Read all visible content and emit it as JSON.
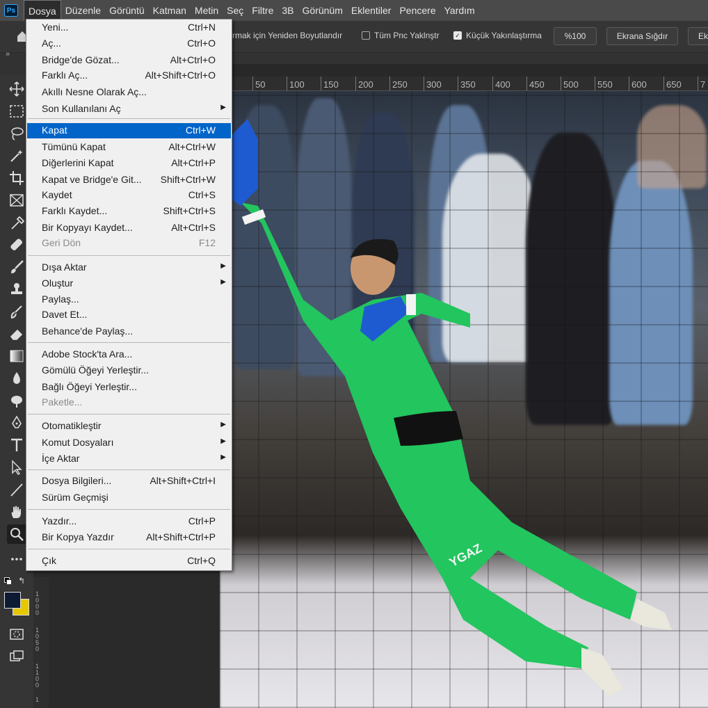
{
  "menubar": {
    "logo": "Ps",
    "items": [
      "Dosya",
      "Düzenle",
      "Görüntü",
      "Katman",
      "Metin",
      "Seç",
      "Filtre",
      "3B",
      "Görünüm",
      "Eklentiler",
      "Pencere",
      "Yardım"
    ],
    "active": "Dosya"
  },
  "optbar": {
    "resize_text": "rmak için Yeniden Boyutlandır",
    "all_windows": "Tüm Pnc Yaklnştr",
    "scrubby_zoom": "Küçük Yakınlaştırma",
    "zoom_value": "%100",
    "fit_screen": "Ekrana Sığdır",
    "fill_screen": "Ek"
  },
  "ruler": {
    "h": [
      "50",
      "100",
      "150",
      "200",
      "250",
      "300",
      "350",
      "400",
      "450",
      "500",
      "550",
      "600",
      "650",
      "7"
    ],
    "v": [
      "1000",
      "1050",
      "1100",
      "1"
    ]
  },
  "file_menu": [
    {
      "label": "Yeni...",
      "shortcut": "Ctrl+N"
    },
    {
      "label": "Aç...",
      "shortcut": "Ctrl+O"
    },
    {
      "label": "Bridge'de Gözat...",
      "shortcut": "Alt+Ctrl+O"
    },
    {
      "label": "Farklı Aç...",
      "shortcut": "Alt+Shift+Ctrl+O"
    },
    {
      "label": "Akıllı Nesne Olarak Aç...",
      "shortcut": ""
    },
    {
      "label": "Son Kullanılanı Aç",
      "shortcut": "",
      "submenu": true
    },
    {
      "label": "Kapat",
      "shortcut": "Ctrl+W",
      "highlighted": true
    },
    {
      "label": "Tümünü Kapat",
      "shortcut": "Alt+Ctrl+W"
    },
    {
      "label": "Diğerlerini Kapat",
      "shortcut": "Alt+Ctrl+P"
    },
    {
      "label": "Kapat ve Bridge'e Git...",
      "shortcut": "Shift+Ctrl+W"
    },
    {
      "label": "Kaydet",
      "shortcut": "Ctrl+S"
    },
    {
      "label": "Farklı Kaydet...",
      "shortcut": "Shift+Ctrl+S"
    },
    {
      "label": "Bir Kopyayı Kaydet...",
      "shortcut": "Alt+Ctrl+S"
    },
    {
      "label": "Geri Dön",
      "shortcut": "F12",
      "disabled": true
    },
    {
      "label": "Dışa Aktar",
      "shortcut": "",
      "submenu": true
    },
    {
      "label": "Oluştur",
      "shortcut": "",
      "submenu": true
    },
    {
      "label": "Paylaş...",
      "shortcut": ""
    },
    {
      "label": "Davet Et...",
      "shortcut": ""
    },
    {
      "label": "Behance'de Paylaş...",
      "shortcut": ""
    },
    {
      "label": "Adobe Stock'ta Ara...",
      "shortcut": ""
    },
    {
      "label": "Gömülü Öğeyi Yerleştir...",
      "shortcut": ""
    },
    {
      "label": "Bağlı Öğeyi Yerleştir...",
      "shortcut": ""
    },
    {
      "label": "Paketle...",
      "shortcut": "",
      "disabled": true
    },
    {
      "label": "Otomatikleştir",
      "shortcut": "",
      "submenu": true
    },
    {
      "label": "Komut Dosyaları",
      "shortcut": "",
      "submenu": true
    },
    {
      "label": "İçe Aktar",
      "shortcut": "",
      "submenu": true
    },
    {
      "label": "Dosya Bilgileri...",
      "shortcut": "Alt+Shift+Ctrl+I"
    },
    {
      "label": "Sürüm Geçmişi",
      "shortcut": ""
    },
    {
      "label": "Yazdır...",
      "shortcut": "Ctrl+P"
    },
    {
      "label": "Bir Kopya Yazdır",
      "shortcut": "Alt+Shift+Ctrl+P"
    },
    {
      "label": "Çık",
      "shortcut": "Ctrl+Q"
    }
  ],
  "photo": {
    "jersey_text": "YGAZ",
    "colors": {
      "kit": "#22c55e",
      "glove": "#1e5bd0"
    }
  },
  "toolbar": {
    "tools": [
      "move-icon",
      "marquee-icon",
      "lasso-icon",
      "magic-wand-icon",
      "crop-icon",
      "frame-icon",
      "eyedropper-icon",
      "healing-icon",
      "brush-icon",
      "stamp-icon",
      "history-brush-icon",
      "eraser-icon",
      "gradient-icon",
      "blur-icon",
      "dodge-icon",
      "pen-icon",
      "type-icon",
      "path-select-icon",
      "line-icon",
      "hand-icon",
      "zoom-icon",
      "more-icon"
    ],
    "selected": "zoom-icon",
    "foreground": "#0d1a33",
    "background": "#e6c700"
  }
}
